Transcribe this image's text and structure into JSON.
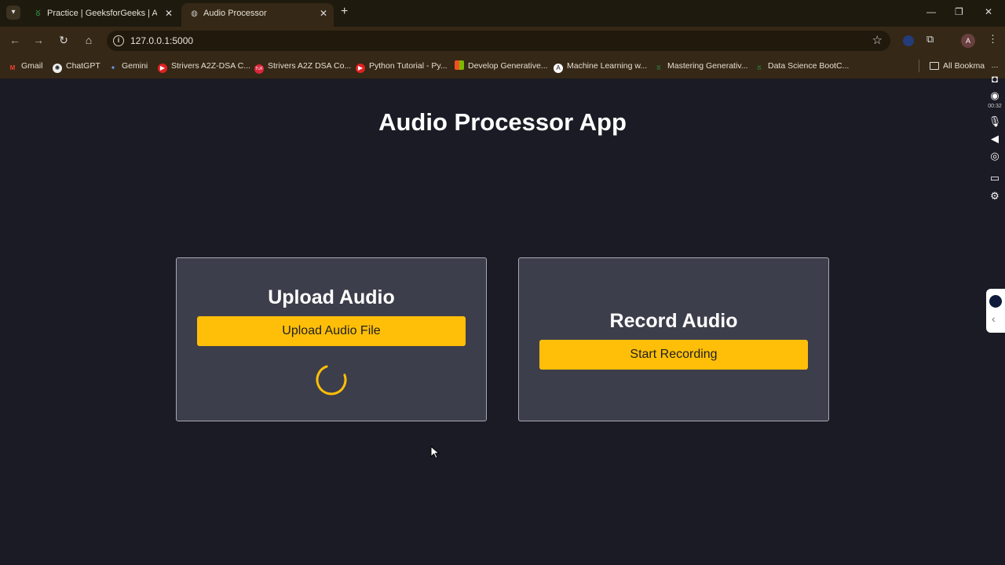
{
  "browser": {
    "tabs": [
      {
        "title": "Practice | GeeksforGeeks | A co",
        "favicon": "gfg-icon",
        "active": false
      },
      {
        "title": "Audio Processor",
        "favicon": "globe-icon",
        "active": true
      }
    ],
    "url": "127.0.0.1:5000",
    "profile_initial": "A",
    "bookmarks": [
      {
        "label": "Gmail",
        "icon": "gmail-icon"
      },
      {
        "label": "ChatGPT",
        "icon": "chatgpt-icon"
      },
      {
        "label": "Gemini",
        "icon": "gemini-icon"
      },
      {
        "label": "Strivers A2Z-DSA C...",
        "icon": "youtube-icon"
      },
      {
        "label": "Strivers A2Z DSA Co...",
        "icon": "tuf-icon"
      },
      {
        "label": "Python Tutorial - Py...",
        "icon": "youtube-icon"
      },
      {
        "label": "Develop Generative...",
        "icon": "microsoft-icon"
      },
      {
        "label": "Machine Learning w...",
        "icon": "deeplearning-icon"
      },
      {
        "label": "Mastering Generativ...",
        "icon": "gfg-icon"
      },
      {
        "label": "Data Science BootC...",
        "icon": "gfg-icon"
      }
    ],
    "all_bookmarks_label": "All Bookma"
  },
  "recorder": {
    "timer": "00:32"
  },
  "page": {
    "title": "Audio Processor App",
    "upload_card": {
      "title": "Upload Audio",
      "button_label": "Upload Audio File"
    },
    "record_card": {
      "title": "Record Audio",
      "button_label": "Start Recording"
    }
  },
  "colors": {
    "page_background": "#1b1b25",
    "card_background": "#3d3e4b",
    "accent": "#ffbf08",
    "browser_frame": "#352816"
  }
}
